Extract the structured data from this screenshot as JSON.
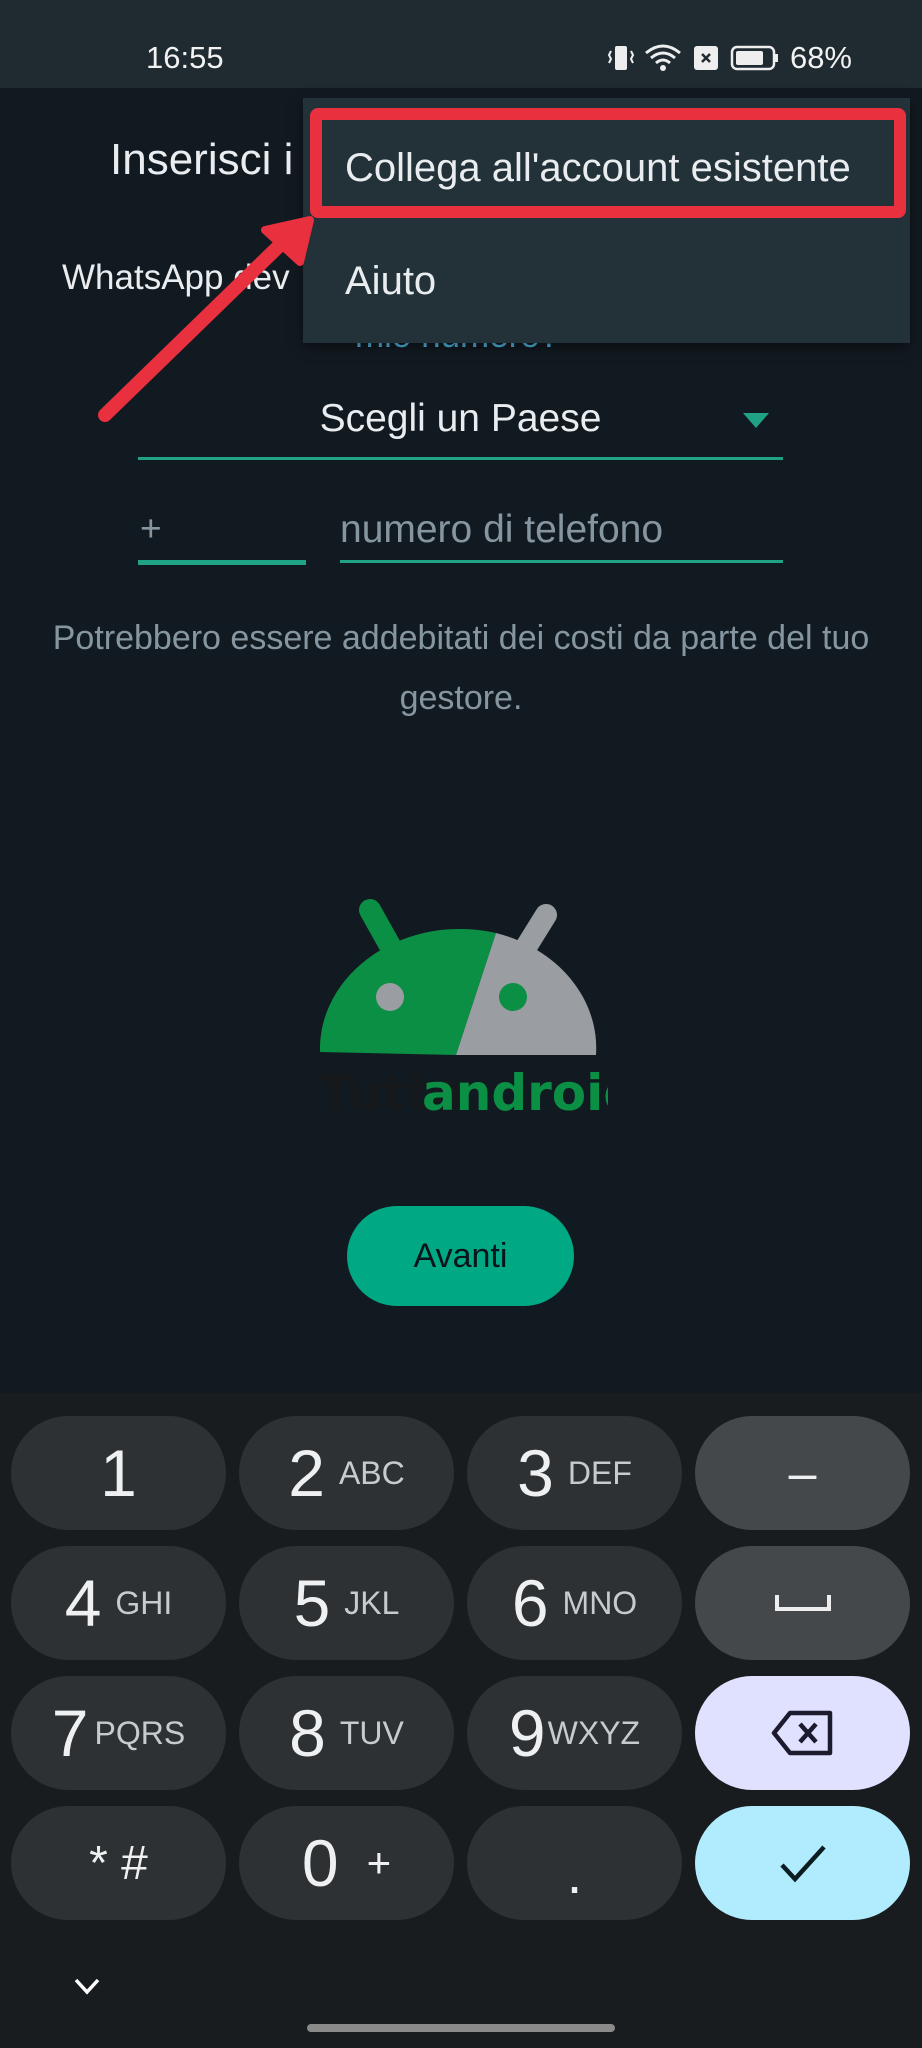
{
  "status_bar": {
    "time": "16:55",
    "icons": [
      "vibrate-icon",
      "wifi-icon",
      "no-sim-icon",
      "battery-icon"
    ],
    "battery": "68%"
  },
  "page": {
    "title_visible": "Inserisci i",
    "description_visible": "WhatsApp dev",
    "link_visible": "mio numero?",
    "country_select": {
      "label": "Scegli un Paese"
    },
    "country_code": {
      "prefix": "+",
      "value": ""
    },
    "phone_input": {
      "placeholder": "numero di telefono",
      "value": ""
    },
    "disclaimer": "Potrebbero essere addebitati dei costi da parte del tuo gestore.",
    "watermark": {
      "part1": "Tutto",
      "part2": "android"
    },
    "next_button": "Avanti"
  },
  "overflow_menu": {
    "items": [
      {
        "label": "Collega all'account esistente",
        "highlighted": true
      },
      {
        "label": "Aiuto",
        "highlighted": false
      }
    ]
  },
  "annotation": {
    "color": "#e8303f"
  },
  "keypad": {
    "keys": [
      {
        "num": "1",
        "sub": ""
      },
      {
        "num": "2",
        "sub": "ABC"
      },
      {
        "num": "3",
        "sub": "DEF"
      },
      {
        "num": "–",
        "sub": ""
      },
      {
        "num": "4",
        "sub": "GHI"
      },
      {
        "num": "5",
        "sub": "JKL"
      },
      {
        "num": "6",
        "sub": "MNO"
      },
      {
        "num": "␣",
        "sub": ""
      },
      {
        "num": "7",
        "sub": "PQRS"
      },
      {
        "num": "8",
        "sub": "TUV"
      },
      {
        "num": "9",
        "sub": "WXYZ"
      },
      {
        "num": "⌫",
        "sub": ""
      },
      {
        "num": "* #",
        "sub": ""
      },
      {
        "num": "0",
        "sub": "+"
      },
      {
        "num": ".",
        "sub": ""
      },
      {
        "num": "✓",
        "sub": ""
      }
    ],
    "collapse": "⌄"
  },
  "colors": {
    "accent": "#00a884",
    "background": "#121a21",
    "menu": "#233138"
  }
}
